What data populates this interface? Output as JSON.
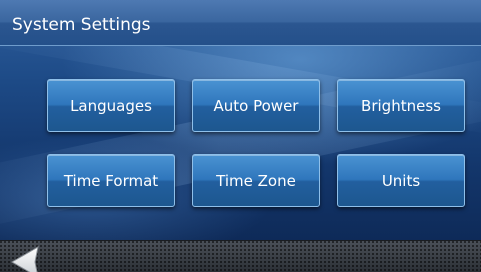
{
  "header": {
    "title": "System Settings"
  },
  "settings": {
    "buttons": [
      {
        "label": "Languages"
      },
      {
        "label": "Auto Power"
      },
      {
        "label": "Brightness"
      },
      {
        "label": "Time Format"
      },
      {
        "label": "Time Zone"
      },
      {
        "label": "Units"
      }
    ]
  },
  "footer": {
    "back_icon": "back-arrow-icon"
  }
}
